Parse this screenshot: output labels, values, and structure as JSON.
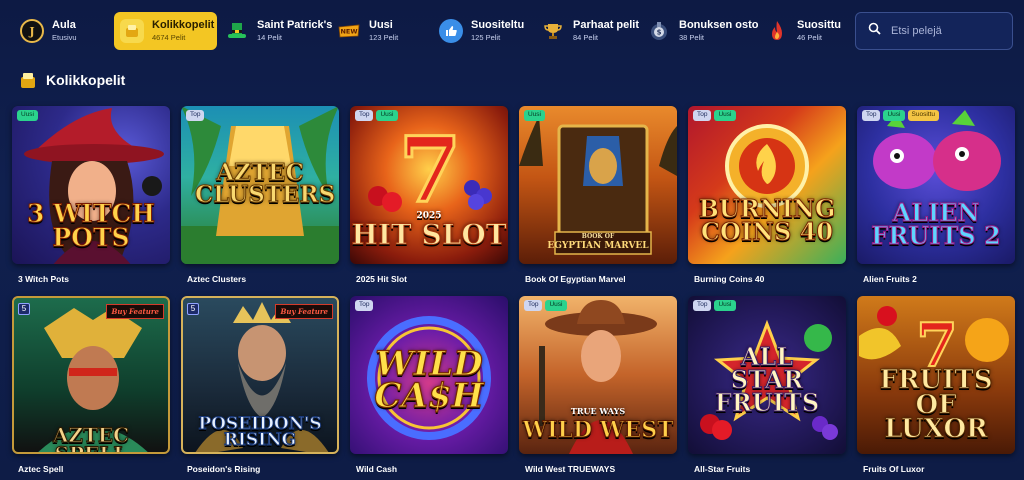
{
  "nav": [
    {
      "label": "Aula",
      "sub": "Etusivu",
      "icon": "joker-icon",
      "active": false
    },
    {
      "label": "Kolikkopelit",
      "sub": "4674 Pelit",
      "icon": "coin-icon",
      "active": true
    },
    {
      "label": "Saint Patrick's",
      "sub": "14 Pelit",
      "icon": "leprechaun-hat-icon",
      "active": false
    },
    {
      "label": "Uusi",
      "sub": "123 Pelit",
      "icon": "new-badge-icon",
      "active": false
    },
    {
      "label": "Suositeltu",
      "sub": "125 Pelit",
      "icon": "thumbs-up-icon",
      "active": false
    },
    {
      "label": "Parhaat pelit",
      "sub": "84 Pelit",
      "icon": "trophy-icon",
      "active": false
    },
    {
      "label": "Bonuksen osto",
      "sub": "38 Pelit",
      "icon": "bonus-buy-icon",
      "active": false
    },
    {
      "label": "Suosittu",
      "sub": "46 Pelit",
      "icon": "flame-icon",
      "active": false
    }
  ],
  "search": {
    "placeholder": "Etsi pelejä"
  },
  "section": {
    "title": "Kolikkopelit"
  },
  "games": [
    {
      "name": "3 Witch Pots",
      "badges": [
        "Uusi"
      ],
      "art": "3 WITCH POTS"
    },
    {
      "name": "Aztec Clusters",
      "badges": [
        "Top"
      ],
      "art": "AZTEC CLUSTERS"
    },
    {
      "name": "2025 Hit Slot",
      "badges": [
        "Top",
        "Uusi"
      ],
      "art": "HIT SLOT",
      "art_small": "2025"
    },
    {
      "name": "Book Of Egyptian Marvel",
      "badges": [
        "Uusi"
      ],
      "art": "EGYPTIAN MARVEL",
      "art_small": "BOOK OF"
    },
    {
      "name": "Burning Coins 40",
      "badges": [
        "Top",
        "Uusi"
      ],
      "art": "BURNING COINS 40"
    },
    {
      "name": "Alien Fruits 2",
      "badges": [
        "Top",
        "Uusi",
        "Suosittu"
      ],
      "art": "ALIEN FRUITS 2"
    },
    {
      "name": "Aztec Spell",
      "badges": [],
      "art": "AZTEC SPELL",
      "ribbon": "Buy Feature",
      "five": "5"
    },
    {
      "name": "Poseidon's Rising",
      "badges": [],
      "art": "POSEIDON'S RISING",
      "ribbon": "Buy Feature",
      "five": "5"
    },
    {
      "name": "Wild Cash",
      "badges": [
        "Top"
      ],
      "art": "WILD CA$H"
    },
    {
      "name": "Wild West TRUEWAYS",
      "badges": [
        "Top",
        "Uusi"
      ],
      "art": "WILD WEST",
      "art_small": "TRUE WAYS"
    },
    {
      "name": "All-Star Fruits",
      "badges": [
        "Top",
        "Uusi"
      ],
      "art": "ALL STAR FRUITS"
    },
    {
      "name": "Fruits Of Luxor",
      "badges": [],
      "art": "FRUITS OF LUXOR"
    }
  ],
  "colors": {
    "accent": "#f3c623",
    "bg": "#0f1d4a",
    "new": "#2bd28d",
    "top": "#cfd6f0",
    "popular": "#f4c544"
  }
}
